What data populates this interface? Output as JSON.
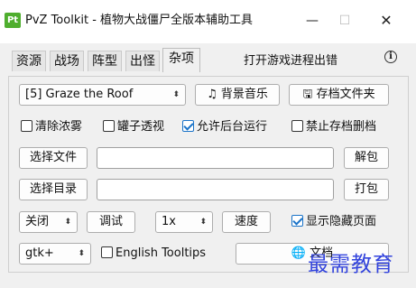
{
  "window": {
    "title": "PvZ Toolkit - 植物大战僵尸全版本辅助工具",
    "icon_text": "Pt",
    "minimize": "—",
    "maximize": "☐",
    "close": "✕"
  },
  "tabs": [
    {
      "label": "资源"
    },
    {
      "label": "战场"
    },
    {
      "label": "阵型"
    },
    {
      "label": "出怪"
    },
    {
      "label": "杂项"
    }
  ],
  "status_text": "打开游戏进程出错",
  "info_icon": "i",
  "misc": {
    "level_select": "[5] Graze the Roof",
    "music_button": "背景音乐",
    "save_folder_button": "存档文件夹",
    "checkboxes": [
      {
        "label": "清除浓雾",
        "checked": false
      },
      {
        "label": "罐子透视",
        "checked": false
      },
      {
        "label": "允许后台运行",
        "checked": true
      },
      {
        "label": "禁止存档删档",
        "checked": false
      }
    ],
    "choose_file_button": "选择文件",
    "file_path": "",
    "unpack_button": "解包",
    "choose_dir_button": "选择目录",
    "dir_path": "",
    "pack_button": "打包",
    "debug_mode_select": "关闭",
    "debug_button": "调试",
    "speed_select": "1x",
    "speed_button": "速度",
    "show_hidden_pages": {
      "label": "显示隐藏页面",
      "checked": true
    },
    "gui_select": "gtk+",
    "english_tooltips": {
      "label": "English Tooltips",
      "checked": false
    },
    "docs_button": "文档"
  },
  "watermark": "最需教育",
  "colors": {
    "accent": "#1a73c8",
    "app_icon": "#4fae2e",
    "watermark": "#3344dd"
  }
}
